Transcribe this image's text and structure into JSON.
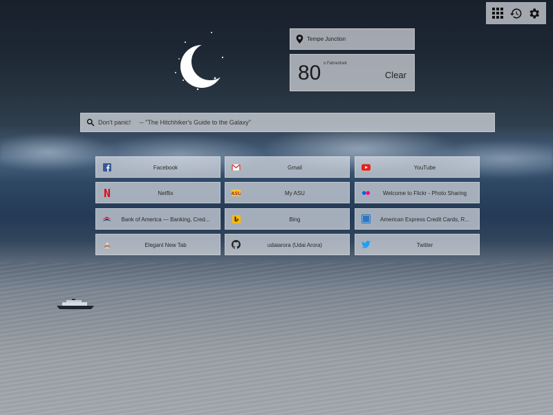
{
  "weather": {
    "location": "Tempe Junction",
    "temperature": "80",
    "unit": "o Fahrenheit",
    "condition": "Clear"
  },
  "search": {
    "placeholder": "Don't panic!     -- \"The Hitchhiker's Guide to the Galaxy\""
  },
  "toolbar": {
    "icons": [
      "apps-grid-icon",
      "history-icon",
      "settings-gear-icon"
    ]
  },
  "shortcuts": [
    {
      "label": "Facebook",
      "icon": "facebook-icon",
      "color": "#3b5998"
    },
    {
      "label": "Gmail",
      "icon": "gmail-icon",
      "color": "#d44638"
    },
    {
      "label": "YouTube",
      "icon": "youtube-icon",
      "color": "#e62117"
    },
    {
      "label": "Netflix",
      "icon": "netflix-icon",
      "color": "#e50914"
    },
    {
      "label": "My ASU",
      "icon": "asu-icon",
      "color": "#8c1d40"
    },
    {
      "label": "Welcome to Flickr - Photo Sharing",
      "icon": "flickr-icon",
      "color": "#ff0084"
    },
    {
      "label": "Bank of America — Banking, Cred...",
      "icon": "bank-of-america-icon",
      "color": "#e31837"
    },
    {
      "label": "Bing",
      "icon": "bing-icon",
      "color": "#ffb900"
    },
    {
      "label": "American Express Credit Cards, R...",
      "icon": "american-express-icon",
      "color": "#2e77bc"
    },
    {
      "label": "Elegant New Tab",
      "icon": "elegant-new-tab-icon",
      "color": "#4a90d9"
    },
    {
      "label": "udaiarora (Udai Arora)",
      "icon": "github-icon",
      "color": "#222222"
    },
    {
      "label": "Twitter",
      "icon": "twitter-icon",
      "color": "#1da1f2"
    }
  ]
}
